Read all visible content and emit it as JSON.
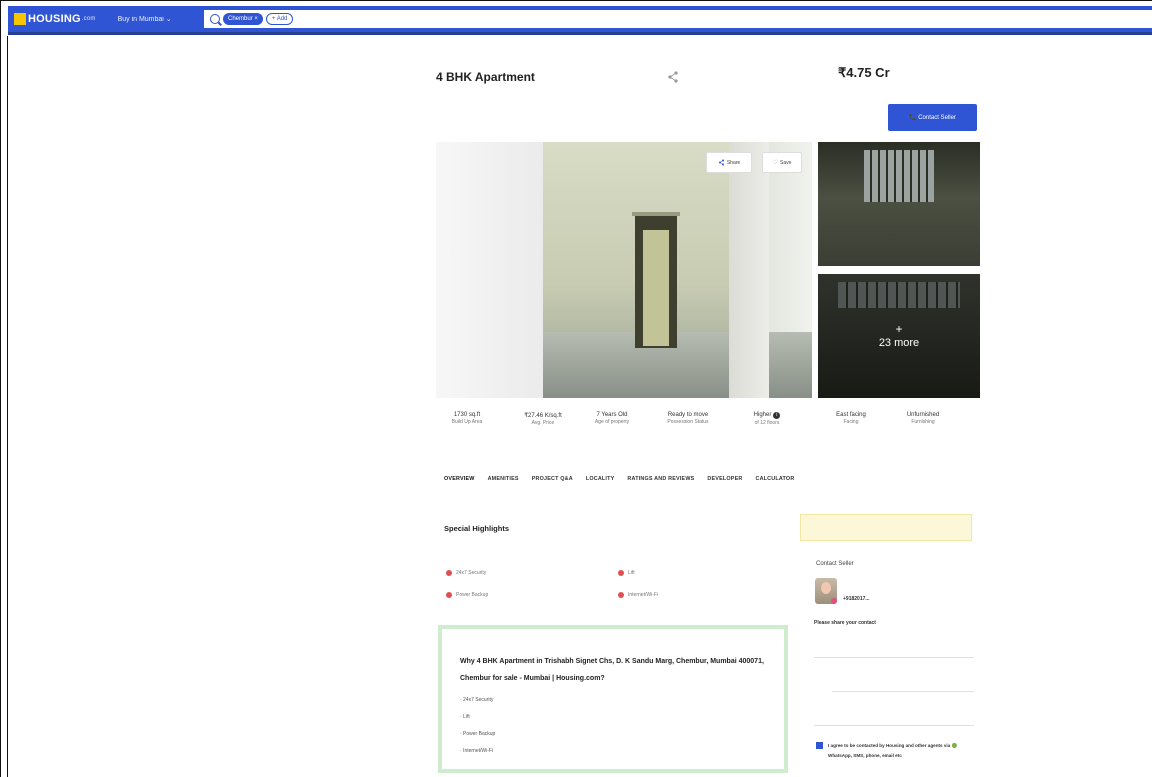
{
  "header": {
    "logo_text": "HOUSING",
    "logo_suffix": ".com",
    "buy_menu": "Buy in Mumbai ⌄",
    "search_chip": "Chembur ×",
    "add_chip": "+ Add"
  },
  "listing": {
    "title": "4 BHK Apartment",
    "price": "₹4.75 Cr",
    "contact_button": "📞 Contact Seller"
  },
  "gallery": {
    "share_label": "Share",
    "save_label": "Save",
    "more_plus": "+",
    "more_text": "23 more"
  },
  "facts": [
    {
      "value": "1730 sq.ft",
      "label": "Build Up Area"
    },
    {
      "value": "₹27.46 K/sq.ft",
      "label": "Avg. Price"
    },
    {
      "value": "7 Years Old",
      "label": "Age of property"
    },
    {
      "value": "Ready to move",
      "label": "Possession Status"
    },
    {
      "value": "Higher",
      "label": "of 12 floors"
    },
    {
      "value": "East facing",
      "label": "Facing"
    },
    {
      "value": "Unfurnished",
      "label": "Furnishing"
    }
  ],
  "tabs": [
    "OVERVIEW",
    "AMENITIES",
    "PROJECT Q&A",
    "LOCALITY",
    "RATINGS AND REVIEWS",
    "DEVELOPER",
    "CALCULATOR"
  ],
  "highlights": {
    "title": "Special Highlights",
    "items": [
      "24x7 Security",
      "Lift",
      "Power Backup",
      "Internet/Wi-Fi"
    ]
  },
  "why_box": {
    "title": "Why 4 BHK Apartment in Trishabh Signet Chs, D. K Sandu Marg, Chembur, Mumbai 400071, Chembur for sale - Mumbai | Housing.com?",
    "items": [
      "· 24x7 Security",
      "· Lift",
      "· Power Backup",
      "· Internet/Wi-Fi"
    ]
  },
  "contact": {
    "title": "Contact Seller",
    "phone": "+9182017...",
    "share_prompt": "Please share your contact",
    "consent": "I agree to be contacted by Housing and other agents via 🟢 WhatsApp, SMS, phone, email etc"
  }
}
